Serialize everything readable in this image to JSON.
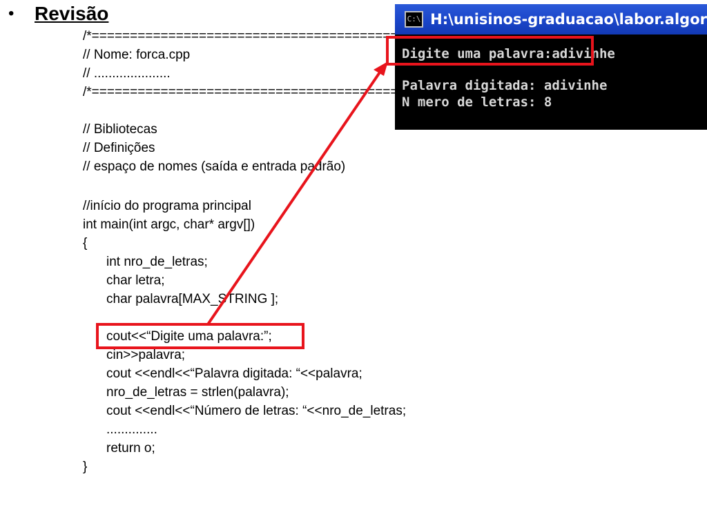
{
  "heading": {
    "bullet": "•",
    "title": "Revisão"
  },
  "code": {
    "lines": [
      "/*===============================================================*/",
      "// Nome: forca.cpp",
      "// .....................",
      "/*===============================================================*/",
      "// Bibliotecas",
      "// Definições",
      "// espaço de nomes (saída e entrada padrão)",
      "//início do programa principal",
      "int main(int argc, char* argv[])",
      "{",
      "int nro_de_letras;",
      "char letra;",
      "char palavra[MAX_STRING ];",
      "cout<<“Digite uma palavra:”;",
      "cin>>palavra;",
      "cout <<endl<<“Palavra digitada: “<<palavra;",
      "nro_de_letras = strlen(palavra);",
      "cout <<endl<<“Número de letras: “<<nro_de_letras;",
      "..............",
      "return o;",
      "}"
    ]
  },
  "terminal": {
    "icon": "C:\\",
    "title": "H:\\unisinos-graduacao\\labor.algor",
    "line1": "Digite uma palavra:adivinhe",
    "line2": "Palavra digitada: adivinhe",
    "line3": "N mero de letras: 8"
  },
  "colors": {
    "highlight": "#e8141c",
    "terminal_bg": "#000000",
    "titlebar": "#1a45c9"
  }
}
